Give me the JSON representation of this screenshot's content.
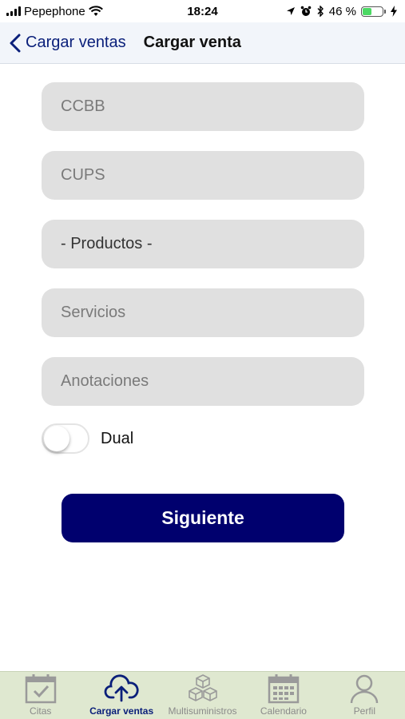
{
  "status_bar": {
    "carrier": "Pepephone",
    "time": "18:24",
    "battery_percent": "46 %"
  },
  "nav": {
    "back_label": "Cargar ventas",
    "title": "Cargar venta"
  },
  "form": {
    "ccbb_placeholder": "CCBB",
    "cups_placeholder": "CUPS",
    "productos_selected": "- Productos -",
    "servicios_placeholder": "Servicios",
    "anotaciones_placeholder": "Anotaciones",
    "dual_label": "Dual",
    "dual_on": false
  },
  "submit_label": "Siguiente",
  "tabs": [
    {
      "label": "Citas",
      "icon": "calendar-check-icon",
      "active": false
    },
    {
      "label": "Cargar ventas",
      "icon": "cloud-upload-icon",
      "active": true
    },
    {
      "label": "Multisuministros",
      "icon": "cubes-icon",
      "active": false
    },
    {
      "label": "Calendario",
      "icon": "calendar-grid-icon",
      "active": false
    },
    {
      "label": "Perfil",
      "icon": "user-icon",
      "active": false
    }
  ],
  "colors": {
    "accent": "#00006e",
    "nav_link": "#0a1f7a",
    "field_bg": "#e0e0e0",
    "tab_bar_bg": "#dfe8d0"
  }
}
